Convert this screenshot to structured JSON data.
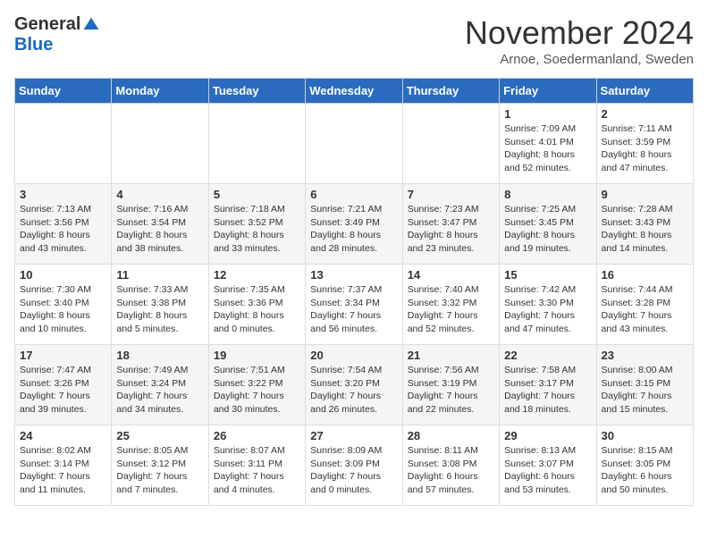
{
  "logo": {
    "general": "General",
    "blue": "Blue"
  },
  "title": "November 2024",
  "subtitle": "Arnoe, Soedermanland, Sweden",
  "days_of_week": [
    "Sunday",
    "Monday",
    "Tuesday",
    "Wednesday",
    "Thursday",
    "Friday",
    "Saturday"
  ],
  "weeks": [
    [
      {
        "day": "",
        "info": ""
      },
      {
        "day": "",
        "info": ""
      },
      {
        "day": "",
        "info": ""
      },
      {
        "day": "",
        "info": ""
      },
      {
        "day": "",
        "info": ""
      },
      {
        "day": "1",
        "info": "Sunrise: 7:09 AM\nSunset: 4:01 PM\nDaylight: 8 hours and 52 minutes."
      },
      {
        "day": "2",
        "info": "Sunrise: 7:11 AM\nSunset: 3:59 PM\nDaylight: 8 hours and 47 minutes."
      }
    ],
    [
      {
        "day": "3",
        "info": "Sunrise: 7:13 AM\nSunset: 3:56 PM\nDaylight: 8 hours and 43 minutes."
      },
      {
        "day": "4",
        "info": "Sunrise: 7:16 AM\nSunset: 3:54 PM\nDaylight: 8 hours and 38 minutes."
      },
      {
        "day": "5",
        "info": "Sunrise: 7:18 AM\nSunset: 3:52 PM\nDaylight: 8 hours and 33 minutes."
      },
      {
        "day": "6",
        "info": "Sunrise: 7:21 AM\nSunset: 3:49 PM\nDaylight: 8 hours and 28 minutes."
      },
      {
        "day": "7",
        "info": "Sunrise: 7:23 AM\nSunset: 3:47 PM\nDaylight: 8 hours and 23 minutes."
      },
      {
        "day": "8",
        "info": "Sunrise: 7:25 AM\nSunset: 3:45 PM\nDaylight: 8 hours and 19 minutes."
      },
      {
        "day": "9",
        "info": "Sunrise: 7:28 AM\nSunset: 3:43 PM\nDaylight: 8 hours and 14 minutes."
      }
    ],
    [
      {
        "day": "10",
        "info": "Sunrise: 7:30 AM\nSunset: 3:40 PM\nDaylight: 8 hours and 10 minutes."
      },
      {
        "day": "11",
        "info": "Sunrise: 7:33 AM\nSunset: 3:38 PM\nDaylight: 8 hours and 5 minutes."
      },
      {
        "day": "12",
        "info": "Sunrise: 7:35 AM\nSunset: 3:36 PM\nDaylight: 8 hours and 0 minutes."
      },
      {
        "day": "13",
        "info": "Sunrise: 7:37 AM\nSunset: 3:34 PM\nDaylight: 7 hours and 56 minutes."
      },
      {
        "day": "14",
        "info": "Sunrise: 7:40 AM\nSunset: 3:32 PM\nDaylight: 7 hours and 52 minutes."
      },
      {
        "day": "15",
        "info": "Sunrise: 7:42 AM\nSunset: 3:30 PM\nDaylight: 7 hours and 47 minutes."
      },
      {
        "day": "16",
        "info": "Sunrise: 7:44 AM\nSunset: 3:28 PM\nDaylight: 7 hours and 43 minutes."
      }
    ],
    [
      {
        "day": "17",
        "info": "Sunrise: 7:47 AM\nSunset: 3:26 PM\nDaylight: 7 hours and 39 minutes."
      },
      {
        "day": "18",
        "info": "Sunrise: 7:49 AM\nSunset: 3:24 PM\nDaylight: 7 hours and 34 minutes."
      },
      {
        "day": "19",
        "info": "Sunrise: 7:51 AM\nSunset: 3:22 PM\nDaylight: 7 hours and 30 minutes."
      },
      {
        "day": "20",
        "info": "Sunrise: 7:54 AM\nSunset: 3:20 PM\nDaylight: 7 hours and 26 minutes."
      },
      {
        "day": "21",
        "info": "Sunrise: 7:56 AM\nSunset: 3:19 PM\nDaylight: 7 hours and 22 minutes."
      },
      {
        "day": "22",
        "info": "Sunrise: 7:58 AM\nSunset: 3:17 PM\nDaylight: 7 hours and 18 minutes."
      },
      {
        "day": "23",
        "info": "Sunrise: 8:00 AM\nSunset: 3:15 PM\nDaylight: 7 hours and 15 minutes."
      }
    ],
    [
      {
        "day": "24",
        "info": "Sunrise: 8:02 AM\nSunset: 3:14 PM\nDaylight: 7 hours and 11 minutes."
      },
      {
        "day": "25",
        "info": "Sunrise: 8:05 AM\nSunset: 3:12 PM\nDaylight: 7 hours and 7 minutes."
      },
      {
        "day": "26",
        "info": "Sunrise: 8:07 AM\nSunset: 3:11 PM\nDaylight: 7 hours and 4 minutes."
      },
      {
        "day": "27",
        "info": "Sunrise: 8:09 AM\nSunset: 3:09 PM\nDaylight: 7 hours and 0 minutes."
      },
      {
        "day": "28",
        "info": "Sunrise: 8:11 AM\nSunset: 3:08 PM\nDaylight: 6 hours and 57 minutes."
      },
      {
        "day": "29",
        "info": "Sunrise: 8:13 AM\nSunset: 3:07 PM\nDaylight: 6 hours and 53 minutes."
      },
      {
        "day": "30",
        "info": "Sunrise: 8:15 AM\nSunset: 3:05 PM\nDaylight: 6 hours and 50 minutes."
      }
    ]
  ]
}
